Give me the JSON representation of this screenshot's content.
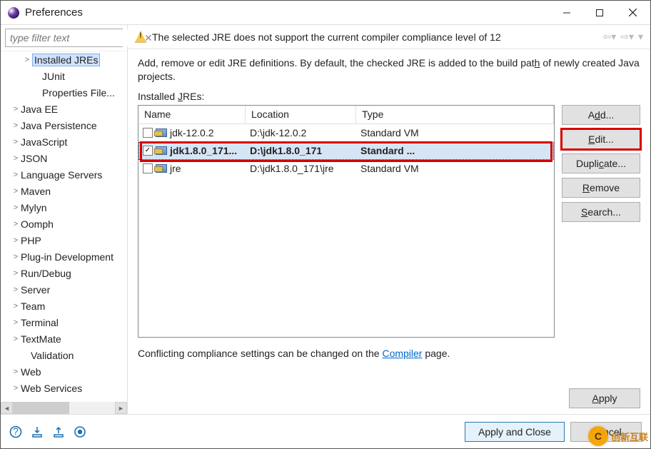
{
  "window": {
    "title": "Preferences"
  },
  "sidebar": {
    "filter_placeholder": "type filter text",
    "items": [
      {
        "label": "Installed JREs",
        "indent": 30,
        "expander": ">",
        "selected": true
      },
      {
        "label": "JUnit",
        "indent": 44,
        "expander": ""
      },
      {
        "label": "Properties File...",
        "indent": 44,
        "expander": ""
      },
      {
        "label": "Java EE",
        "indent": 14,
        "expander": ">"
      },
      {
        "label": "Java Persistence",
        "indent": 14,
        "expander": ">"
      },
      {
        "label": "JavaScript",
        "indent": 14,
        "expander": ">"
      },
      {
        "label": "JSON",
        "indent": 14,
        "expander": ">"
      },
      {
        "label": "Language Servers",
        "indent": 14,
        "expander": ">"
      },
      {
        "label": "Maven",
        "indent": 14,
        "expander": ">"
      },
      {
        "label": "Mylyn",
        "indent": 14,
        "expander": ">"
      },
      {
        "label": "Oomph",
        "indent": 14,
        "expander": ">"
      },
      {
        "label": "PHP",
        "indent": 14,
        "expander": ">"
      },
      {
        "label": "Plug-in Development",
        "indent": 14,
        "expander": ">"
      },
      {
        "label": "Run/Debug",
        "indent": 14,
        "expander": ">"
      },
      {
        "label": "Server",
        "indent": 14,
        "expander": ">"
      },
      {
        "label": "Team",
        "indent": 14,
        "expander": ">"
      },
      {
        "label": "Terminal",
        "indent": 14,
        "expander": ">"
      },
      {
        "label": "TextMate",
        "indent": 14,
        "expander": ">"
      },
      {
        "label": "Validation",
        "indent": 28,
        "expander": ""
      },
      {
        "label": "Web",
        "indent": 14,
        "expander": ">"
      },
      {
        "label": "Web Services",
        "indent": 14,
        "expander": ">"
      }
    ]
  },
  "warning": "The selected JRE does not support the current compiler compliance level of 12",
  "description": {
    "prefix": "Add, remove or edit JRE definitions. By default, the checked JRE is added to the build pat",
    "underl": "h",
    "suffix": " of newly created Java projects."
  },
  "list_label_prefix": "Installed ",
  "list_label_ul": "J",
  "list_label_suffix": "REs:",
  "columns": {
    "name": "Name",
    "location": "Location",
    "type": "Type"
  },
  "rows": [
    {
      "checked": false,
      "name": "jdk-12.0.2",
      "location": "D:\\jdk-12.0.2",
      "type": "Standard VM",
      "bold": false,
      "selected": false
    },
    {
      "checked": true,
      "name": "jdk1.8.0_171...",
      "location": "D:\\jdk1.8.0_171",
      "type": "Standard ...",
      "bold": true,
      "selected": true
    },
    {
      "checked": false,
      "name": "jre",
      "location": "D:\\jdk1.8.0_171\\jre",
      "type": "Standard VM",
      "bold": false,
      "selected": false
    }
  ],
  "buttons": {
    "add_pre": "A",
    "add_ul": "d",
    "add_post": "d...",
    "edit_pre": "",
    "edit_ul": "E",
    "edit_post": "dit...",
    "dup_pre": "Dupli",
    "dup_ul": "c",
    "dup_post": "ate...",
    "rem_pre": "",
    "rem_ul": "R",
    "rem_post": "emove",
    "search_pre": "",
    "search_ul": "S",
    "search_post": "earch..."
  },
  "conflict_prefix": "Conflicting compliance settings can be changed on the ",
  "conflict_link": "Compiler",
  "conflict_suffix": " page.",
  "apply_label_pre": "",
  "apply_label_ul": "A",
  "apply_label_post": "pply",
  "footer": {
    "apply_close": "Apply and Close",
    "cancel": "Cancel"
  },
  "watermark": {
    "logo": "C",
    "text": "创新互联"
  }
}
